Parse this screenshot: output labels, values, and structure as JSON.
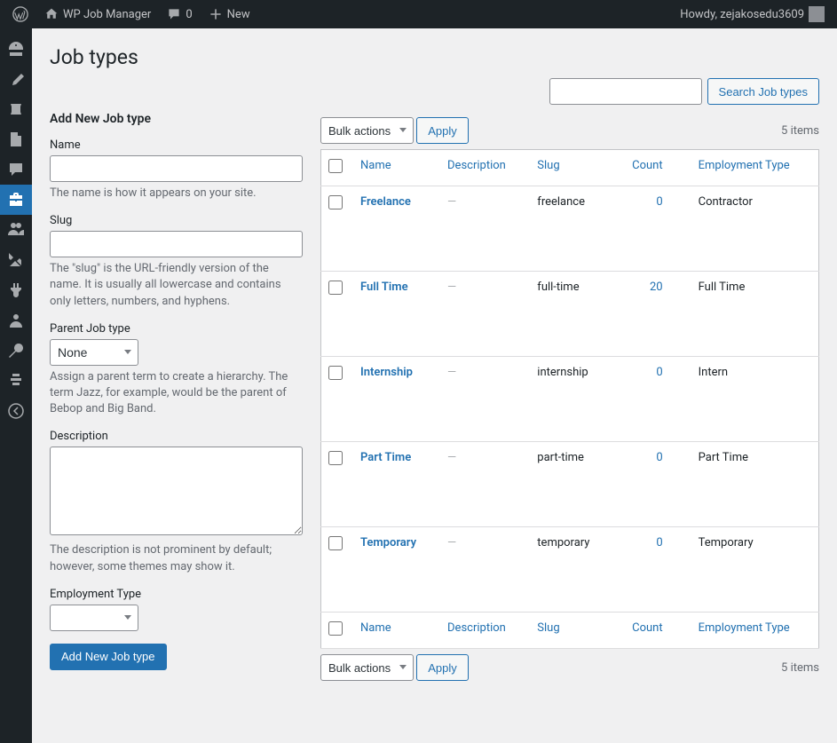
{
  "adminbar": {
    "site_name": "WP Job Manager",
    "comment_count": "0",
    "new_label": "New",
    "howdy": "Howdy, zejakosedu3609"
  },
  "page_title": "Job types",
  "search": {
    "button": "Search Job types"
  },
  "form": {
    "heading": "Add New Job type",
    "name_label": "Name",
    "name_desc": "The name is how it appears on your site.",
    "slug_label": "Slug",
    "slug_desc": "The \"slug\" is the URL-friendly version of the name. It is usually all lowercase and contains only letters, numbers, and hyphens.",
    "parent_label": "Parent Job type",
    "parent_option": "None",
    "parent_desc": "Assign a parent term to create a hierarchy. The term Jazz, for example, would be the parent of Bebop and Big Band.",
    "desc_label": "Description",
    "desc_desc": "The description is not prominent by default; however, some themes may show it.",
    "emp_label": "Employment Type",
    "submit": "Add New Job type"
  },
  "bulk_actions_label": "Bulk actions",
  "apply_label": "Apply",
  "items_count": "5 items",
  "columns": {
    "name": "Name",
    "description": "Description",
    "slug": "Slug",
    "count": "Count",
    "employment": "Employment Type"
  },
  "rows": [
    {
      "name": "Freelance",
      "desc": "—",
      "slug": "freelance",
      "count": "0",
      "emp": "Contractor"
    },
    {
      "name": "Full Time",
      "desc": "—",
      "slug": "full-time",
      "count": "20",
      "emp": "Full Time"
    },
    {
      "name": "Internship",
      "desc": "—",
      "slug": "internship",
      "count": "0",
      "emp": "Intern"
    },
    {
      "name": "Part Time",
      "desc": "—",
      "slug": "part-time",
      "count": "0",
      "emp": "Part Time"
    },
    {
      "name": "Temporary",
      "desc": "—",
      "slug": "temporary",
      "count": "0",
      "emp": "Temporary"
    }
  ]
}
